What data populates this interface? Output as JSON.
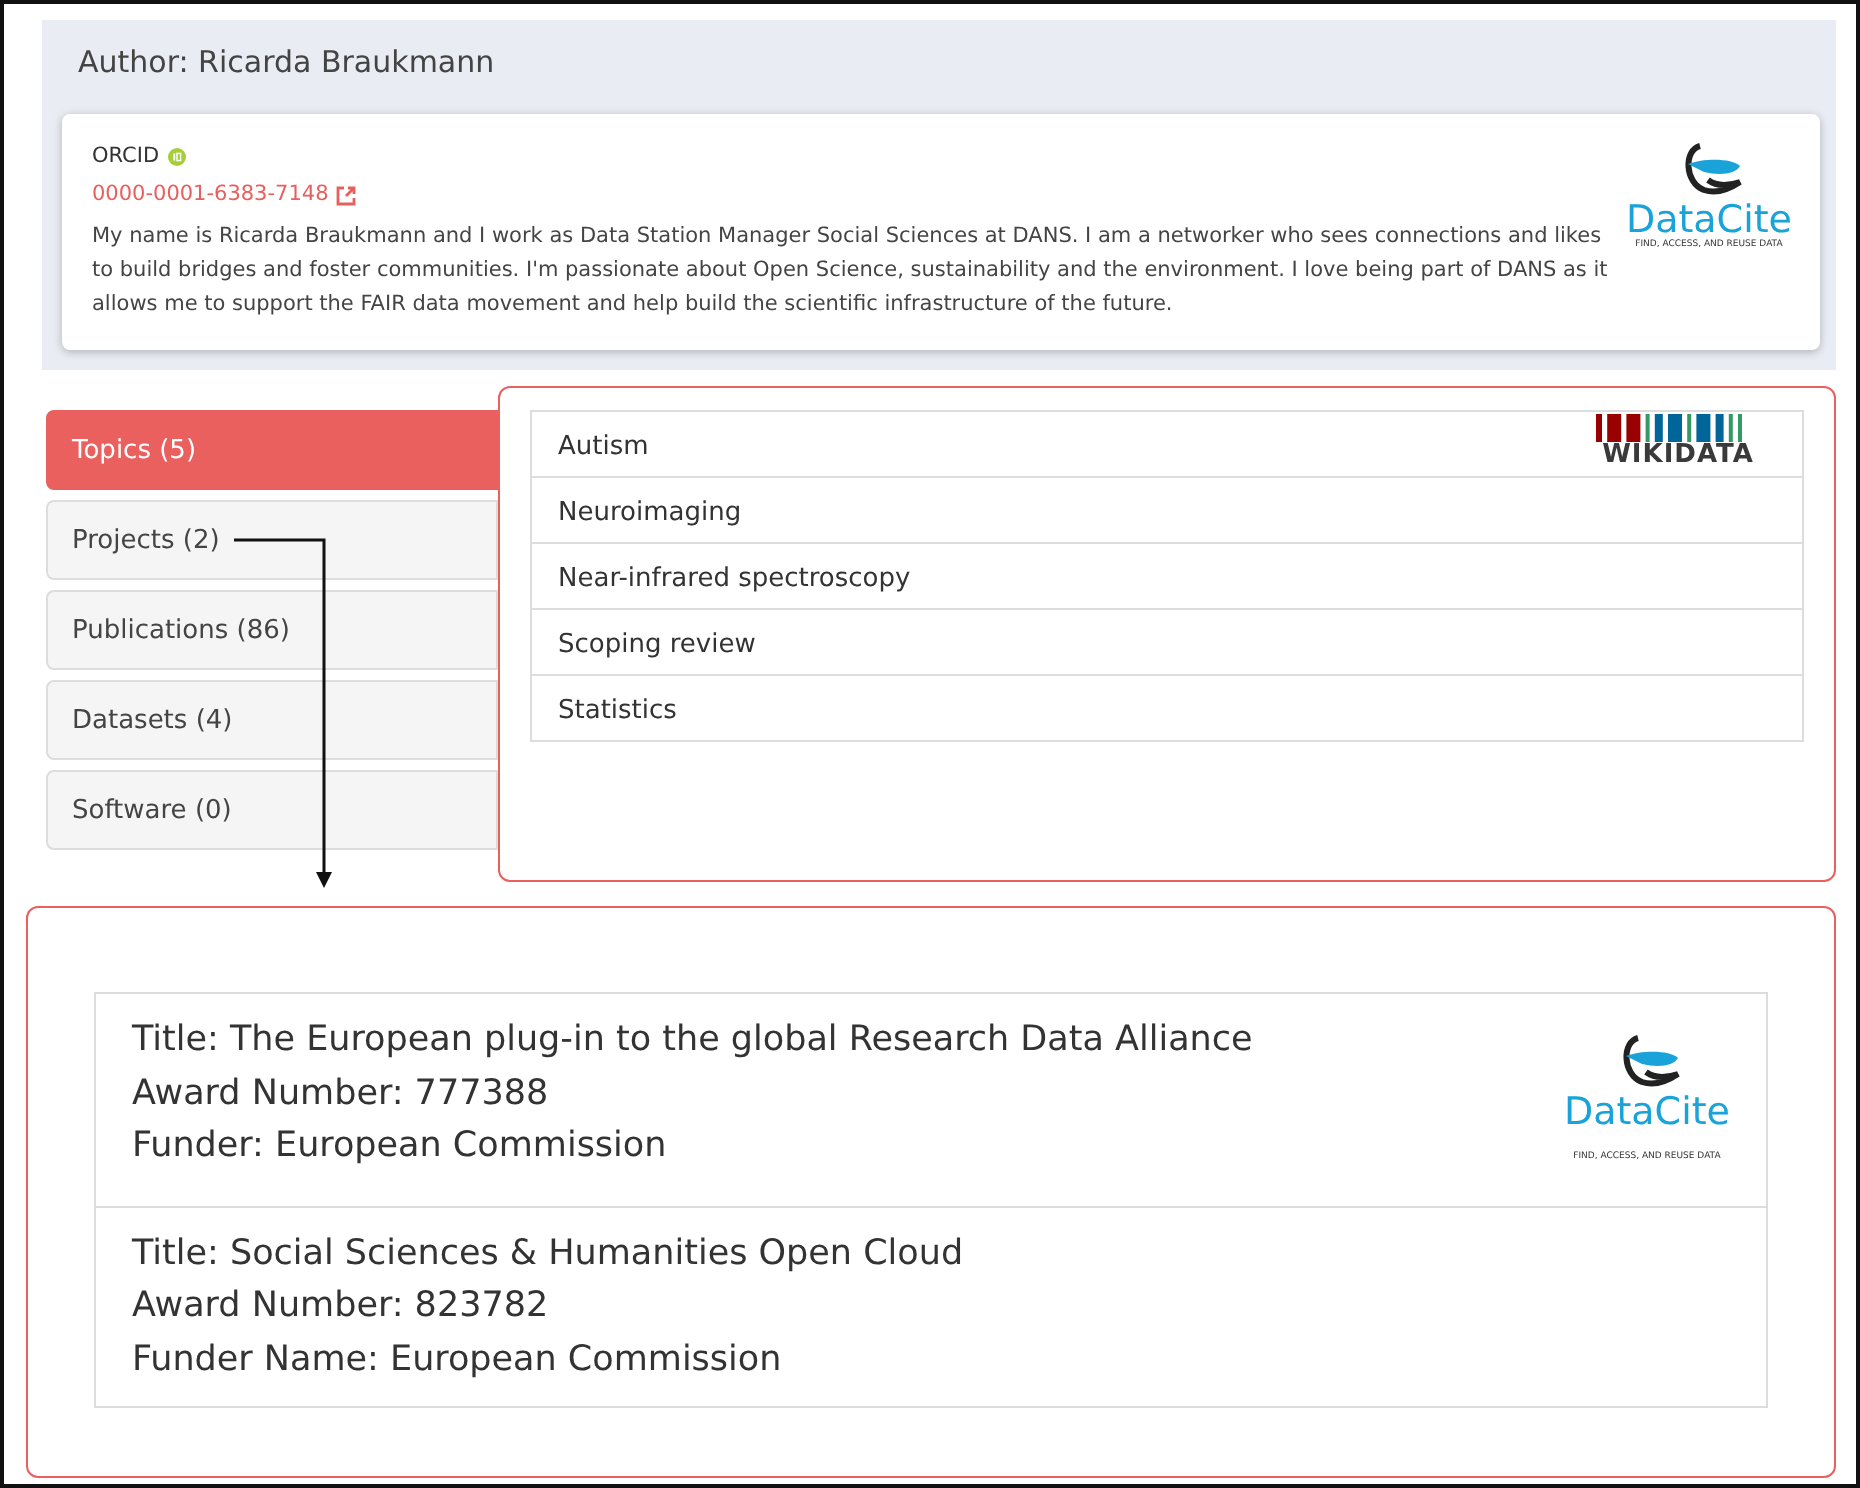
{
  "author": {
    "title": "Author: Ricarda Braukmann",
    "orcid_label": "ORCID",
    "orcid_id": "0000-0001-6383-7148",
    "bio": "My name is Ricarda Braukmann and I work as Data Station Manager Social Sciences at DANS. I am a networker who sees connections and likes to build bridges and foster communities. I'm passionate about Open Science, sustainability and the environment. I love being part of DANS as it allows me to support the FAIR data movement and help build the scientific infrastructure of the future.",
    "logo": {
      "name": "DataCite",
      "tagline": "FIND, ACCESS, AND REUSE DATA"
    }
  },
  "tabs": [
    {
      "label": "Topics (5)",
      "selected": true
    },
    {
      "label": "Projects (2)",
      "selected": false
    },
    {
      "label": "Publications (86)",
      "selected": false
    },
    {
      "label": "Datasets (4)",
      "selected": false
    },
    {
      "label": "Software (0)",
      "selected": false
    }
  ],
  "topics": {
    "items": [
      "Autism",
      "Neuroimaging",
      "Near-infrared spectroscopy",
      "Scoping review",
      "Statistics"
    ],
    "logo": {
      "name": "WIKIDATA"
    }
  },
  "projects": {
    "items": [
      {
        "lines": [
          "Title: The European plug-in to the global Research Data Alliance",
          "Award Number: 777388",
          "Funder: European Commission"
        ]
      },
      {
        "lines": [
          "Title: Social Sciences & Humanities Open Cloud",
          "Award Number: 823782",
          "Funder Name: European Commission"
        ]
      }
    ],
    "logo": {
      "name": "DataCite",
      "tagline": "FIND, ACCESS, AND REUSE DATA"
    }
  }
}
